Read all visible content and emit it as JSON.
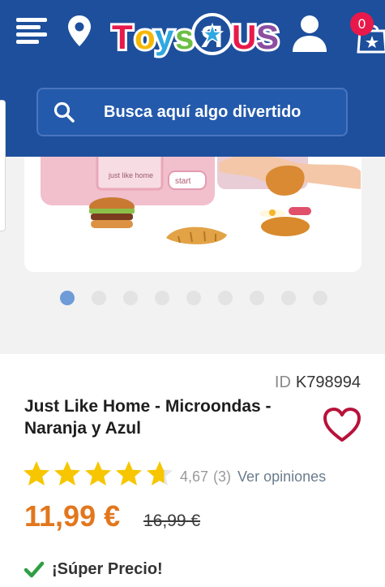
{
  "header": {
    "brand": "Toys R Us",
    "cart_count": "0",
    "search_placeholder": "Busca aquí algo divertido"
  },
  "gallery": {
    "slide_count": 9,
    "active_slide": 1,
    "microwave_label": "just like home",
    "microwave_button": "start"
  },
  "product": {
    "id_label": "ID",
    "id_value": "K798994",
    "title": "Just Like Home - Microondas - Naranja y Azul",
    "rating": "4,67",
    "rating_value": 4.67,
    "reviews": "(3)",
    "reviews_link": "Ver opiniones",
    "price": "11,99 €",
    "old_price": "16,99 €",
    "badge": "¡Súper Precio!"
  },
  "colors": {
    "header_bg": "#1d4f9c",
    "price": "#e2771d",
    "star": "#f7c600",
    "heart": "#b8123a",
    "check": "#2f9e44",
    "cart_badge": "#e8194a"
  }
}
